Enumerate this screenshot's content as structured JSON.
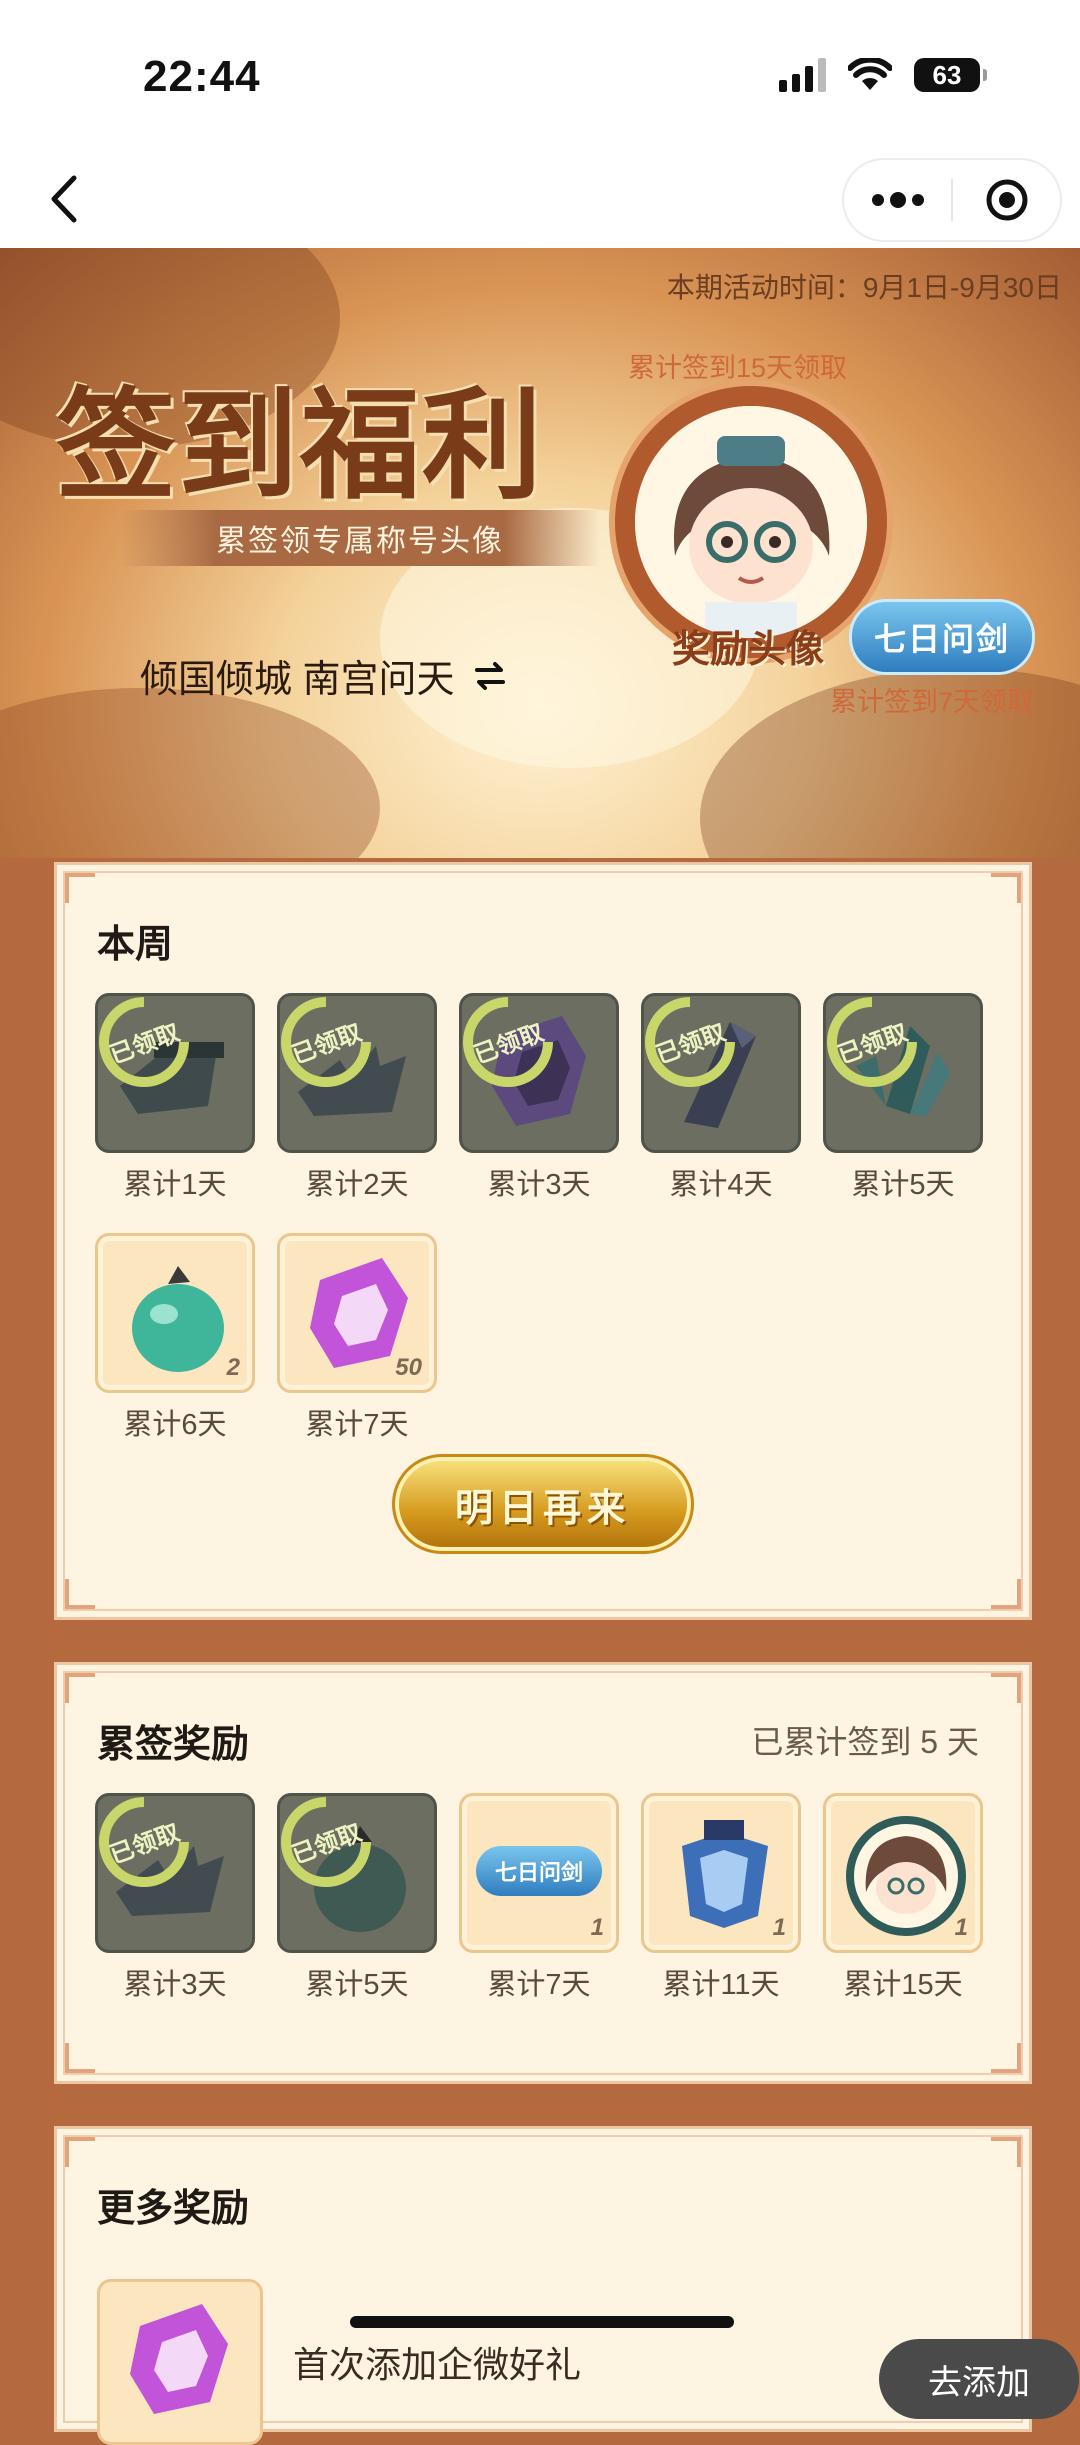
{
  "status_bar": {
    "time": "22:44",
    "battery": "63"
  },
  "nav": {
    "back_icon": "chevron-left-icon",
    "more_icon": "more-dots-icon",
    "close_icon": "target-icon"
  },
  "banner": {
    "period": "本期活动时间：9月1日-9月30日",
    "title": "签到福利",
    "subtitle": "累签领专属称号头像",
    "user_name": "倾国倾城 南宫问天",
    "switch_icon": "swap-icon",
    "reward_15_note": "累计签到15天领取",
    "reward_avatar_label": "奖励头像",
    "title_badge": "七日问剑",
    "reward_7_note": "累计签到7天领取"
  },
  "weekly": {
    "title": "本周",
    "items": [
      {
        "label": "累计1天",
        "state": "claimed",
        "icon": "cannon-icon"
      },
      {
        "label": "累计2天",
        "state": "claimed",
        "icon": "broken-cannon-icon"
      },
      {
        "label": "累计3天",
        "state": "claimed",
        "icon": "purple-gem-icon"
      },
      {
        "label": "累计4天",
        "state": "claimed",
        "icon": "crystal-shard-icon"
      },
      {
        "label": "累计5天",
        "state": "claimed",
        "icon": "green-crystal-icon"
      },
      {
        "label": "累计6天",
        "state": "available",
        "icon": "green-pouch-icon",
        "qty": "2"
      },
      {
        "label": "累计7天",
        "state": "available",
        "icon": "purple-gem-icon",
        "qty": "50"
      }
    ],
    "stamp_text": "已领取",
    "button": "明日再来"
  },
  "cumulative": {
    "title": "累签奖励",
    "summary": "已累计签到 5 天",
    "items": [
      {
        "label": "累计3天",
        "state": "claimed",
        "icon": "broken-cannon-icon"
      },
      {
        "label": "累计5天",
        "state": "claimed",
        "icon": "green-pouch-icon"
      },
      {
        "label": "累计7天",
        "state": "available",
        "icon": "title-badge-icon",
        "badge": "七日问剑",
        "qty": "1"
      },
      {
        "label": "累计11天",
        "state": "available",
        "icon": "blue-frame-icon",
        "qty": "1"
      },
      {
        "label": "累计15天",
        "state": "available",
        "icon": "avatar-icon",
        "qty": "1"
      }
    ]
  },
  "more": {
    "title": "更多奖励",
    "first_item": "首次添加企微好礼",
    "go_button": "去添加"
  }
}
